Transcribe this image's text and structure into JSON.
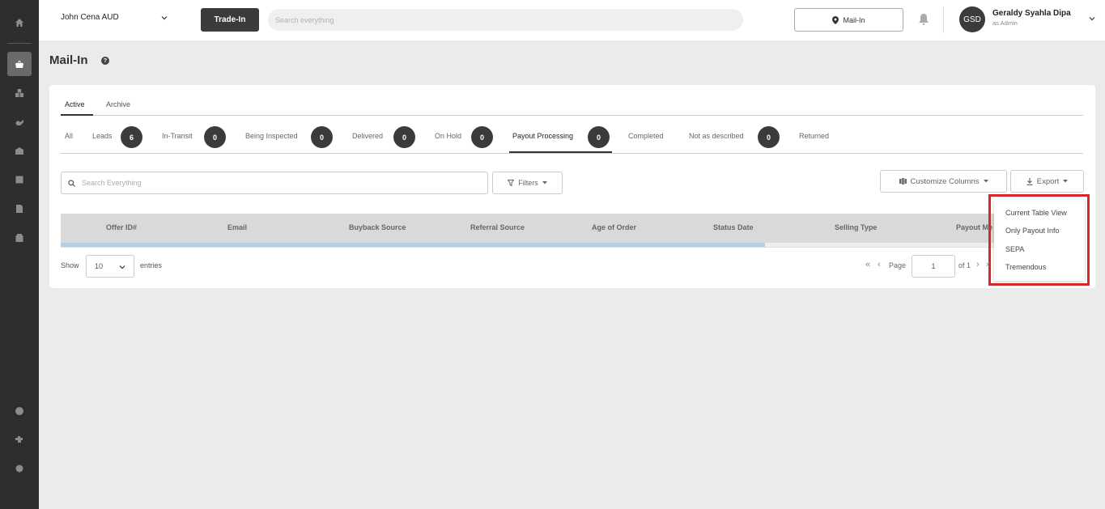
{
  "store": {
    "name": "John Cena AUD"
  },
  "topbar": {
    "tradein_label": "Trade-In",
    "search_placeholder": "Search everything",
    "mailin_label": "Mail-In",
    "avatar_initials": "GSD",
    "user_name": "Geraldy Syahla Dipa",
    "user_role": "as Admin"
  },
  "page": {
    "title": "Mail-In",
    "help": "?"
  },
  "tabs": {
    "active": "Active",
    "archive": "Archive"
  },
  "status_tabs": {
    "all": "All",
    "leads": "Leads",
    "leads_count": "6",
    "in_transit": "In-Transit",
    "in_transit_count": "0",
    "being_inspected": "Being Inspected",
    "being_inspected_count": "0",
    "delivered": "Delivered",
    "delivered_count": "0",
    "on_hold": "On Hold",
    "on_hold_count": "0",
    "payout_processing": "Payout Processing",
    "payout_processing_count": "0",
    "completed": "Completed",
    "not_as_described": "Not as described",
    "not_as_described_count": "0",
    "returned": "Returned"
  },
  "toolbar": {
    "search_placeholder": "Search Everything",
    "filters_label": "Filters",
    "customize_label": "Customize Columns",
    "export_label": "Export"
  },
  "table": {
    "columns": [
      "Offer ID#",
      "Email",
      "Buyback Source",
      "Referral Source",
      "Age of Order",
      "Status Date",
      "Selling Type",
      "Payout Me"
    ],
    "loading_progress": 0.75
  },
  "pagination": {
    "show_label": "Show",
    "page_size": "10",
    "entries_label": "entries",
    "page_label": "Page",
    "current_page": "1",
    "of_label": "of 1"
  },
  "export_menu": {
    "items": [
      "Current Table View",
      "Only Payout Info",
      "SEPA",
      "Tremendous"
    ]
  },
  "colors": {
    "sidebar": "#2e2e2e",
    "highlight": "#d9262b",
    "badge": "#3b3b3b",
    "progress": "#b5cde5"
  }
}
